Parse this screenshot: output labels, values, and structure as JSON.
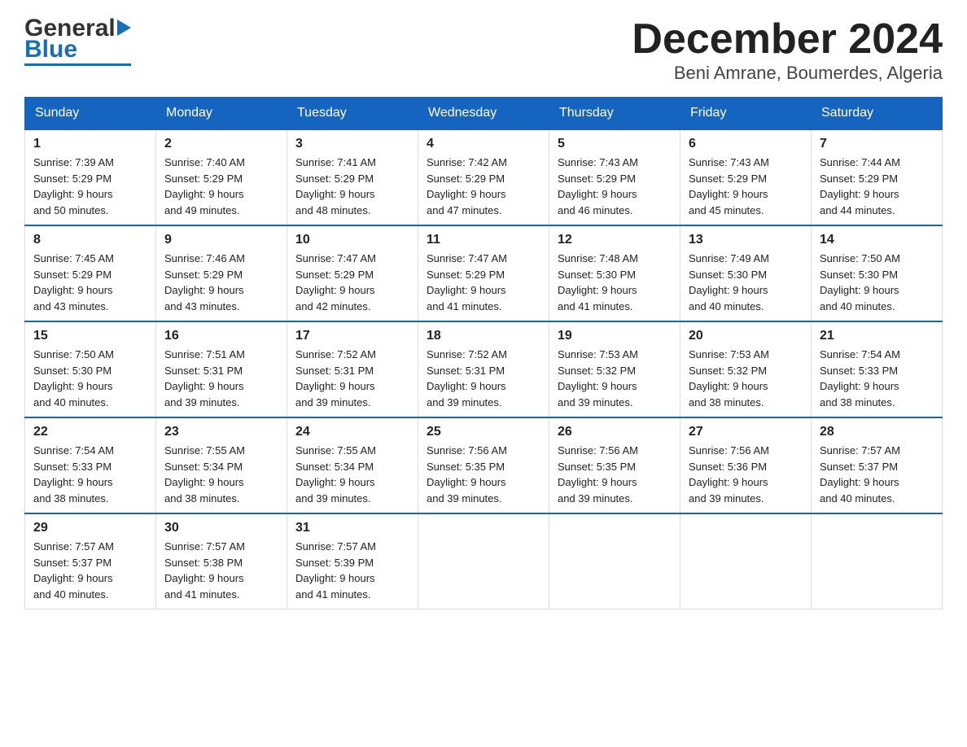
{
  "header": {
    "logo_general": "General",
    "logo_blue": "Blue",
    "title": "December 2024",
    "subtitle": "Beni Amrane, Boumerdes, Algeria"
  },
  "calendar": {
    "days_of_week": [
      "Sunday",
      "Monday",
      "Tuesday",
      "Wednesday",
      "Thursday",
      "Friday",
      "Saturday"
    ],
    "weeks": [
      [
        {
          "day": "1",
          "sunrise": "7:39 AM",
          "sunset": "5:29 PM",
          "daylight": "9 hours and 50 minutes."
        },
        {
          "day": "2",
          "sunrise": "7:40 AM",
          "sunset": "5:29 PM",
          "daylight": "9 hours and 49 minutes."
        },
        {
          "day": "3",
          "sunrise": "7:41 AM",
          "sunset": "5:29 PM",
          "daylight": "9 hours and 48 minutes."
        },
        {
          "day": "4",
          "sunrise": "7:42 AM",
          "sunset": "5:29 PM",
          "daylight": "9 hours and 47 minutes."
        },
        {
          "day": "5",
          "sunrise": "7:43 AM",
          "sunset": "5:29 PM",
          "daylight": "9 hours and 46 minutes."
        },
        {
          "day": "6",
          "sunrise": "7:43 AM",
          "sunset": "5:29 PM",
          "daylight": "9 hours and 45 minutes."
        },
        {
          "day": "7",
          "sunrise": "7:44 AM",
          "sunset": "5:29 PM",
          "daylight": "9 hours and 44 minutes."
        }
      ],
      [
        {
          "day": "8",
          "sunrise": "7:45 AM",
          "sunset": "5:29 PM",
          "daylight": "9 hours and 43 minutes."
        },
        {
          "day": "9",
          "sunrise": "7:46 AM",
          "sunset": "5:29 PM",
          "daylight": "9 hours and 43 minutes."
        },
        {
          "day": "10",
          "sunrise": "7:47 AM",
          "sunset": "5:29 PM",
          "daylight": "9 hours and 42 minutes."
        },
        {
          "day": "11",
          "sunrise": "7:47 AM",
          "sunset": "5:29 PM",
          "daylight": "9 hours and 41 minutes."
        },
        {
          "day": "12",
          "sunrise": "7:48 AM",
          "sunset": "5:30 PM",
          "daylight": "9 hours and 41 minutes."
        },
        {
          "day": "13",
          "sunrise": "7:49 AM",
          "sunset": "5:30 PM",
          "daylight": "9 hours and 40 minutes."
        },
        {
          "day": "14",
          "sunrise": "7:50 AM",
          "sunset": "5:30 PM",
          "daylight": "9 hours and 40 minutes."
        }
      ],
      [
        {
          "day": "15",
          "sunrise": "7:50 AM",
          "sunset": "5:30 PM",
          "daylight": "9 hours and 40 minutes."
        },
        {
          "day": "16",
          "sunrise": "7:51 AM",
          "sunset": "5:31 PM",
          "daylight": "9 hours and 39 minutes."
        },
        {
          "day": "17",
          "sunrise": "7:52 AM",
          "sunset": "5:31 PM",
          "daylight": "9 hours and 39 minutes."
        },
        {
          "day": "18",
          "sunrise": "7:52 AM",
          "sunset": "5:31 PM",
          "daylight": "9 hours and 39 minutes."
        },
        {
          "day": "19",
          "sunrise": "7:53 AM",
          "sunset": "5:32 PM",
          "daylight": "9 hours and 39 minutes."
        },
        {
          "day": "20",
          "sunrise": "7:53 AM",
          "sunset": "5:32 PM",
          "daylight": "9 hours and 38 minutes."
        },
        {
          "day": "21",
          "sunrise": "7:54 AM",
          "sunset": "5:33 PM",
          "daylight": "9 hours and 38 minutes."
        }
      ],
      [
        {
          "day": "22",
          "sunrise": "7:54 AM",
          "sunset": "5:33 PM",
          "daylight": "9 hours and 38 minutes."
        },
        {
          "day": "23",
          "sunrise": "7:55 AM",
          "sunset": "5:34 PM",
          "daylight": "9 hours and 38 minutes."
        },
        {
          "day": "24",
          "sunrise": "7:55 AM",
          "sunset": "5:34 PM",
          "daylight": "9 hours and 39 minutes."
        },
        {
          "day": "25",
          "sunrise": "7:56 AM",
          "sunset": "5:35 PM",
          "daylight": "9 hours and 39 minutes."
        },
        {
          "day": "26",
          "sunrise": "7:56 AM",
          "sunset": "5:35 PM",
          "daylight": "9 hours and 39 minutes."
        },
        {
          "day": "27",
          "sunrise": "7:56 AM",
          "sunset": "5:36 PM",
          "daylight": "9 hours and 39 minutes."
        },
        {
          "day": "28",
          "sunrise": "7:57 AM",
          "sunset": "5:37 PM",
          "daylight": "9 hours and 40 minutes."
        }
      ],
      [
        {
          "day": "29",
          "sunrise": "7:57 AM",
          "sunset": "5:37 PM",
          "daylight": "9 hours and 40 minutes."
        },
        {
          "day": "30",
          "sunrise": "7:57 AM",
          "sunset": "5:38 PM",
          "daylight": "9 hours and 41 minutes."
        },
        {
          "day": "31",
          "sunrise": "7:57 AM",
          "sunset": "5:39 PM",
          "daylight": "9 hours and 41 minutes."
        },
        null,
        null,
        null,
        null
      ]
    ]
  },
  "colors": {
    "header_bg": "#1565c0",
    "header_text": "#ffffff",
    "border_color": "#1565c0",
    "logo_blue": "#1a6eb5"
  },
  "labels": {
    "sunrise_prefix": "Sunrise: ",
    "sunset_prefix": "Sunset: ",
    "daylight_prefix": "Daylight: "
  }
}
